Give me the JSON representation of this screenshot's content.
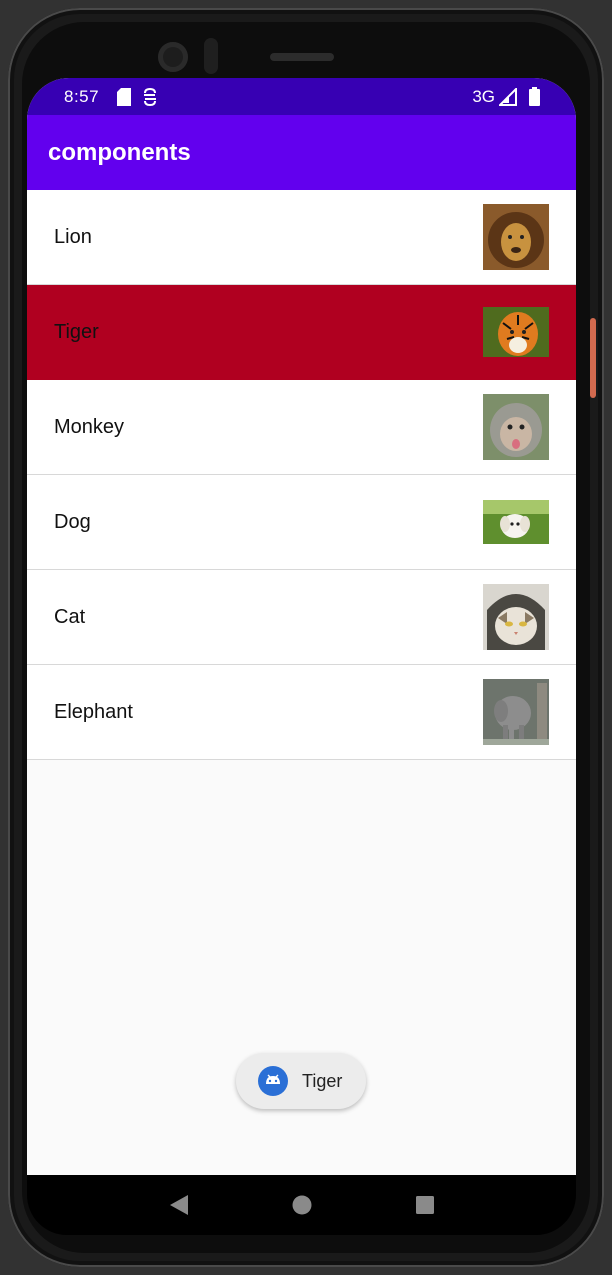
{
  "status_bar": {
    "time": "8:57",
    "network": "3G",
    "icons": [
      "sd-card-icon",
      "sync-icon",
      "signal-icon",
      "battery-icon"
    ]
  },
  "app_bar": {
    "title": "components",
    "color": "#6200ee"
  },
  "list": {
    "items": [
      {
        "label": "Lion",
        "image": "lion-image",
        "selected": false
      },
      {
        "label": "Tiger",
        "image": "tiger-image",
        "selected": true
      },
      {
        "label": "Monkey",
        "image": "monkey-image",
        "selected": false
      },
      {
        "label": "Dog",
        "image": "dog-image",
        "selected": false
      },
      {
        "label": "Cat",
        "image": "cat-image",
        "selected": false
      },
      {
        "label": "Elephant",
        "image": "elephant-image",
        "selected": false
      }
    ],
    "selected_color": "#b00020"
  },
  "toast": {
    "text": "Tiger",
    "icon": "android-icon"
  },
  "nav_bar": {
    "buttons": [
      "back-icon",
      "home-icon",
      "recents-icon"
    ]
  }
}
